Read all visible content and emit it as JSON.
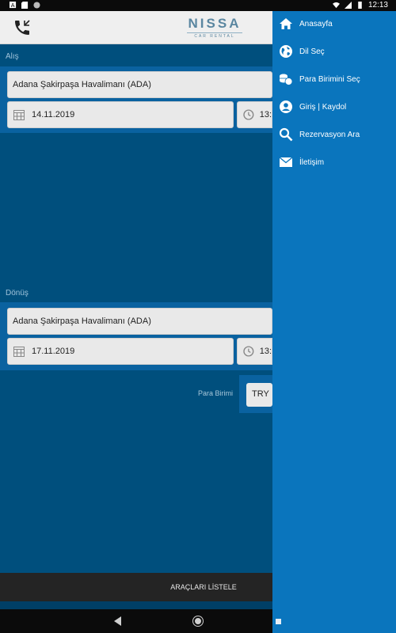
{
  "status_bar": {
    "time": "12:13"
  },
  "app_bar": {
    "logo_brand": "NISSA",
    "logo_sub": "CAR RENTAL"
  },
  "pickup": {
    "label": "Alış",
    "location": "Adana Şakirpaşa Havalimanı (ADA)",
    "date": "14.11.2019",
    "time": "13:"
  },
  "return": {
    "label": "Dönüş",
    "location": "Adana Şakirpaşa Havalimanı (ADA)",
    "date": "17.11.2019",
    "time": "13:"
  },
  "currency": {
    "label": "Para Birimi",
    "value": "TRY"
  },
  "list_button": {
    "label": "ARAÇLARI LİSTELE"
  },
  "drawer": {
    "items": [
      {
        "label": "Anasayfa",
        "icon": "home-icon"
      },
      {
        "label": "Dil Seç",
        "icon": "globe-icon"
      },
      {
        "label": "Para Birimini Seç",
        "icon": "coins-icon"
      },
      {
        "label": "Giriş | Kaydol",
        "icon": "user-icon"
      },
      {
        "label": "Rezervasyon Ara",
        "icon": "search-icon"
      },
      {
        "label": "İletişim",
        "icon": "mail-icon"
      }
    ]
  },
  "colors": {
    "background": "#004f7d",
    "panel": "#0a62a0",
    "drawer": "#0a75bd",
    "list_bar": "#242424"
  }
}
